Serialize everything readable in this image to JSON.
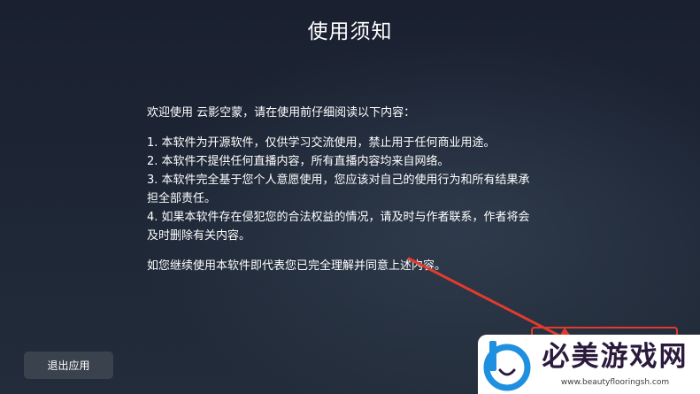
{
  "dialog": {
    "title": "使用须知",
    "intro": "欢迎使用 云影空蒙，请在使用前仔细阅读以下内容：",
    "items": [
      [
        "1. 本软件为开源软件，仅供学习交流使用，禁止用于任何商业用途。"
      ],
      [
        "2. 本软件不提供任何直播内容，所有直播内容均来自网络。"
      ],
      [
        "3. 本软件完全基于您个人意愿使用，您应该对自己的使用行为和所有结果承",
        "担全部责任。"
      ],
      [
        "4. 如果本软件存在侵犯您的合法权益的情况，请及时与作者联系，作者将会",
        "及时删除有关内容。"
      ]
    ],
    "footer": "如您继续使用本软件即代表您已完全理解并同意上述内容。",
    "exit_button_label": "退出应用"
  },
  "annotation": {
    "color": "#e23b2e"
  },
  "watermark": {
    "text": "必美游戏网",
    "url": "www.beautyflooringsh.com",
    "logo_color": "#1f8fe0"
  }
}
